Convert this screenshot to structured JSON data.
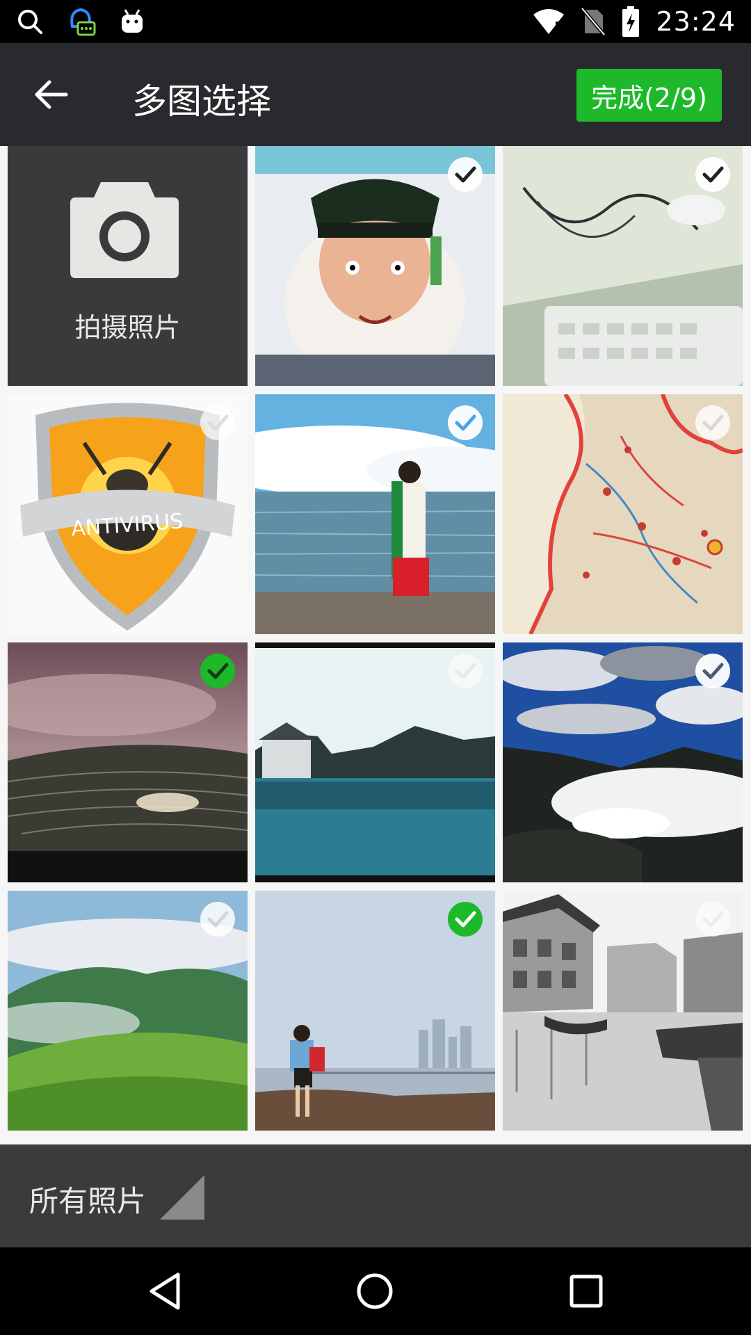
{
  "status_bar": {
    "time": "23:24",
    "icons": [
      "search-icon",
      "qq-chat-icon",
      "android-icon",
      "wifi-icon",
      "no-sim-icon",
      "battery-charging-icon"
    ]
  },
  "toolbar": {
    "back_icon": "arrow-left-icon",
    "title": "多图选择",
    "done_label": "完成(2/9)"
  },
  "camera": {
    "icon": "camera-icon",
    "label": "拍摄照片"
  },
  "photos": [
    {
      "subject": "anime character on monitor",
      "selected": false
    },
    {
      "subject": "desk with cables and mouse",
      "selected": false
    },
    {
      "subject": "antivirus shield logo",
      "selected": false
    },
    {
      "subject": "woman by the sea",
      "selected": false
    },
    {
      "subject": "map of Sichuan and Yunnan",
      "selected": false
    },
    {
      "subject": "terraced fields at dusk",
      "selected": true
    },
    {
      "subject": "village by a lake",
      "selected": false
    },
    {
      "subject": "mountains above clouds",
      "selected": false
    },
    {
      "subject": "green hills with mist",
      "selected": false
    },
    {
      "subject": "girl on rocks by the coast",
      "selected": true
    },
    {
      "subject": "water town black and white",
      "selected": false
    }
  ],
  "bottom_bar": {
    "album_label": "所有照片"
  },
  "nav_bar": {
    "icons": [
      "back-triangle-icon",
      "home-circle-icon",
      "recents-square-icon"
    ]
  },
  "colors": {
    "accent_green": "#1db92a",
    "toolbar_bg": "#282a2d",
    "bottom_bar_bg": "#3b3b3d"
  }
}
